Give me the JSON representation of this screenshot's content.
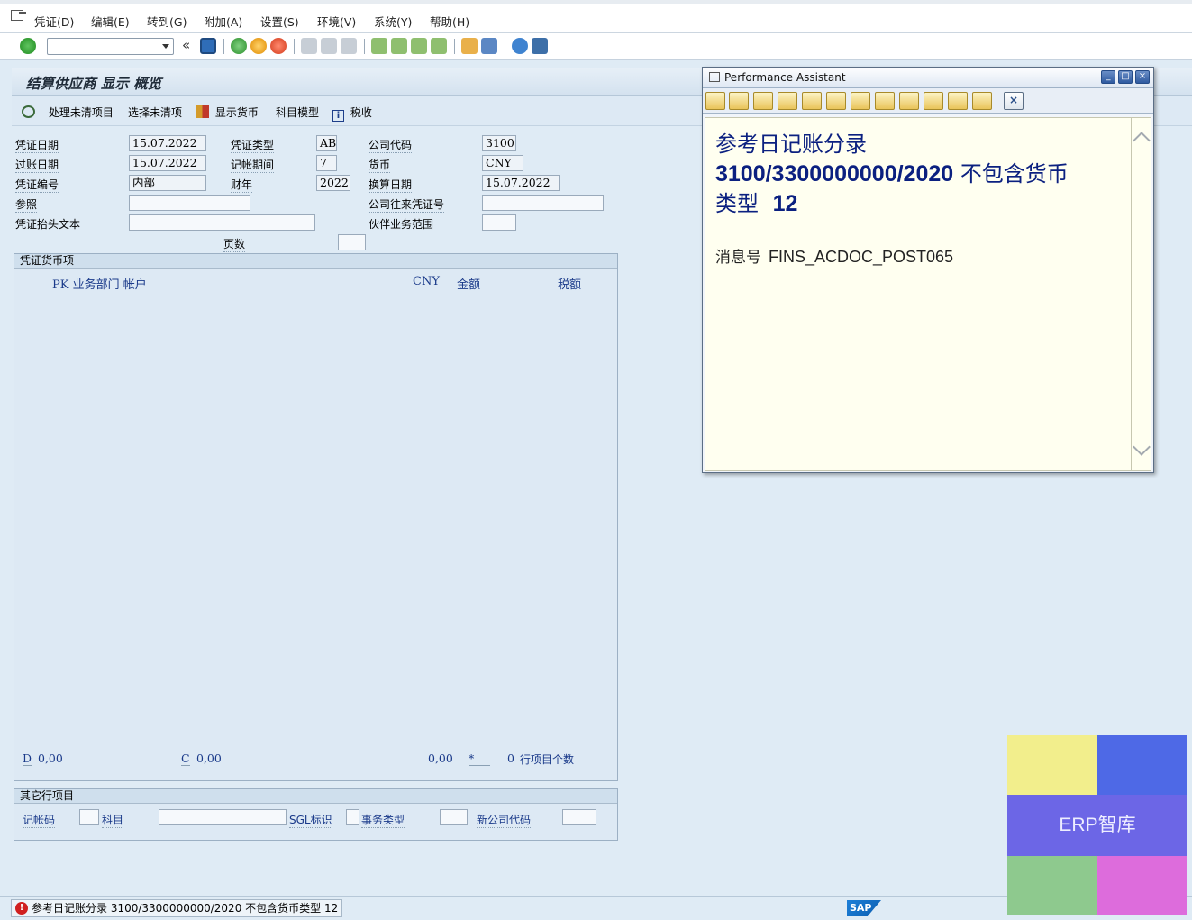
{
  "menu": [
    "凭证(D)",
    "编辑(E)",
    "转到(G)",
    "附加(A)",
    "设置(S)",
    "环境(V)",
    "系统(Y)",
    "帮助(H)"
  ],
  "toolbar": {
    "back_chevron": "«",
    "command_field_value": ""
  },
  "page_title": "结算供应商 显示 概览",
  "app_toolbar": {
    "process_open_items": "处理未清项目",
    "select_open_items": "选择未清项",
    "display_currency": "显示货币",
    "account_model": "科目模型",
    "taxes": "税收"
  },
  "header": {
    "doc_date_label": "凭证日期",
    "doc_date": "15.07.2022",
    "posting_date_label": "过账日期",
    "posting_date": "15.07.2022",
    "doc_number_label": "凭证编号",
    "doc_number": "内部",
    "reference_label": "参照",
    "reference": "",
    "header_text_label": "凭证抬头文本",
    "header_text": "",
    "doc_type_label": "凭证类型",
    "doc_type": "AB",
    "period_label": "记帐期间",
    "period": "7",
    "fiscal_year_label": "财年",
    "fiscal_year": "2022",
    "company_code_label": "公司代码",
    "company_code": "3100",
    "currency_label": "货币",
    "currency": "CNY",
    "translation_date_label": "换算日期",
    "translation_date": "15.07.2022",
    "intercompany_label": "公司往来凭证号",
    "intercompany": "",
    "trading_partner_label": "伙伴业务范围",
    "trading_partner": "",
    "page_label": "页数",
    "page": ""
  },
  "items": {
    "title": "凭证货币项",
    "col_pk": "PK 业务部门 帐户",
    "col_currency": "CNY",
    "col_amount": "金额",
    "col_tax": "税额",
    "debit_label": "D",
    "debit_total": "0,00",
    "credit_label": "C",
    "credit_total": "0,00",
    "balance": "0,00",
    "balance_marker": "*",
    "line_count": "0",
    "line_count_label": "行项目个数"
  },
  "other_item": {
    "title": "其它行项目",
    "posting_key_label": "记帐码",
    "posting_key": "",
    "account_label": "科目",
    "account": "",
    "sgl_label": "SGL标识",
    "sgl": "",
    "trans_type_label": "事务类型",
    "trans_type": "",
    "new_cc_label": "新公司代码",
    "new_cc": ""
  },
  "status_bar": {
    "message": "参考日记账分录 3100/3300000000/2020 不包含货币类型 12",
    "brand": "SAP"
  },
  "perf_assistant": {
    "title": "Performance Assistant",
    "heading_line1": "参考日记账分录",
    "heading_doc": "3100/3300000000/2020",
    "heading_line2_cn": "不包含货币",
    "heading_line3_cn": "类型",
    "heading_num": "12",
    "msg_label": "消息号",
    "msg_code": "FINS_ACDOC_POST065"
  },
  "watermark": {
    "text": "ERP智库",
    "colors": [
      "#f2ee8c",
      "#4e69e6",
      "#6c66e6",
      "#8ec98e",
      "#dd6cdc"
    ]
  }
}
